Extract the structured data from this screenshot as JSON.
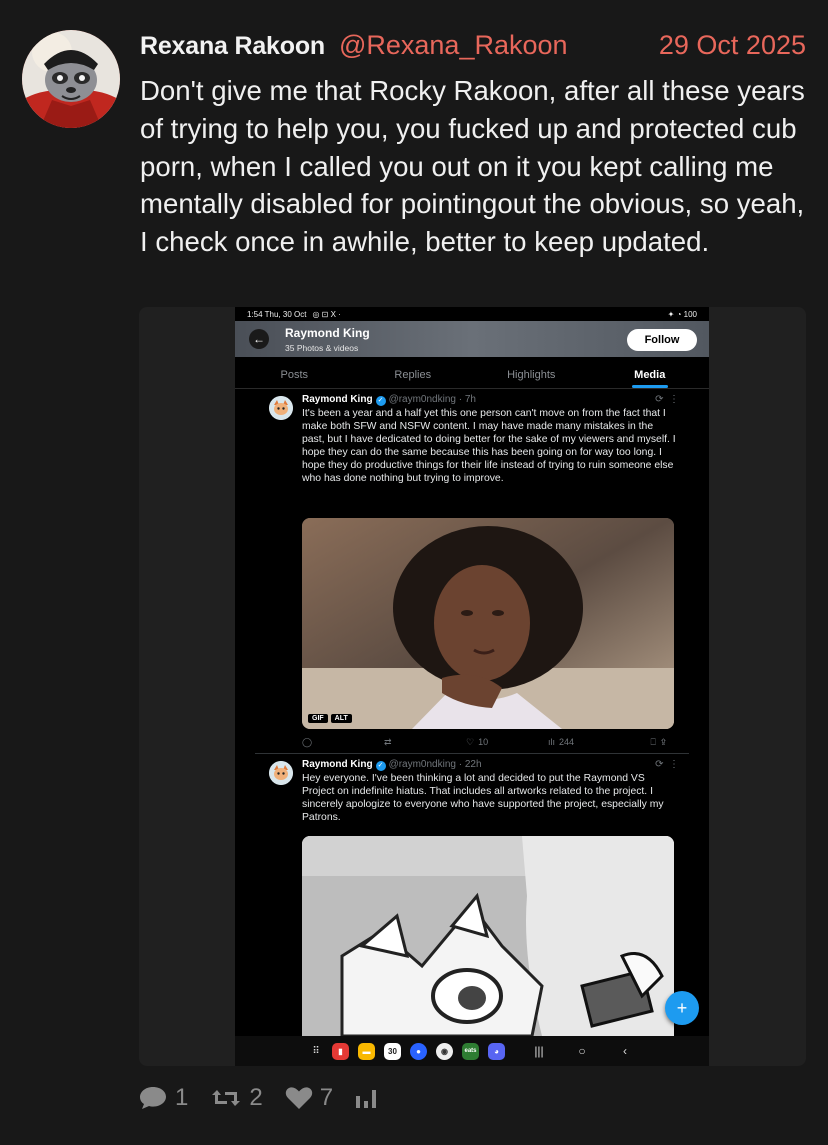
{
  "post": {
    "display_name": "Rexana Rakoon",
    "handle": "@Rexana_Rakoon",
    "date": "29 Oct 2025",
    "text": "Don't give me that Rocky Rakoon, after all these years of trying to help you, you fucked up and protected cub porn, when I called you out on it you kept calling me mentally disabled for pointingout the obvious, so yeah, I check once in awhile, better to keep updated.",
    "stats": {
      "replies": "1",
      "reposts": "2",
      "likes": "7"
    }
  },
  "screenshot": {
    "status_time": "1:54  Thu, 30 Oct",
    "status_icons": "◎ ⊡ X ·",
    "status_right": "✦ ◔ 100",
    "profile_name": "Raymond King",
    "profile_count": "35 Photos & videos",
    "follow_label": "Follow",
    "tabs": [
      "Posts",
      "Replies",
      "Highlights",
      "Media"
    ],
    "tweets": [
      {
        "name": "Raymond King",
        "meta": "@raym0ndking · 7h",
        "text": "It's been a year and a half yet this one person can't move on from the fact that I make both SFW and NSFW content. I may have made many mistakes in the past, but I have dedicated to doing better for the sake of my viewers and myself. I hope they can do the same because this has been going on for way too long. I hope they do productive things for their life instead of trying to ruin someone else who has done nothing but trying to improve.",
        "badges": [
          "GIF",
          "ALT"
        ],
        "likes": "10",
        "views": "244"
      },
      {
        "name": "Raymond King",
        "meta": "@raym0ndking · 22h",
        "text": "Hey everyone. I've been thinking a lot and decided to put the Raymond VS Project on indefinite hiatus. That includes all artworks related to the project. I sincerely apologize to everyone who have supported the project, especially my Patrons."
      }
    ],
    "calendar_day": "30",
    "colors": {
      "accent": "#1d9bf0",
      "handle": "#e8675b",
      "background": "#181818"
    }
  }
}
